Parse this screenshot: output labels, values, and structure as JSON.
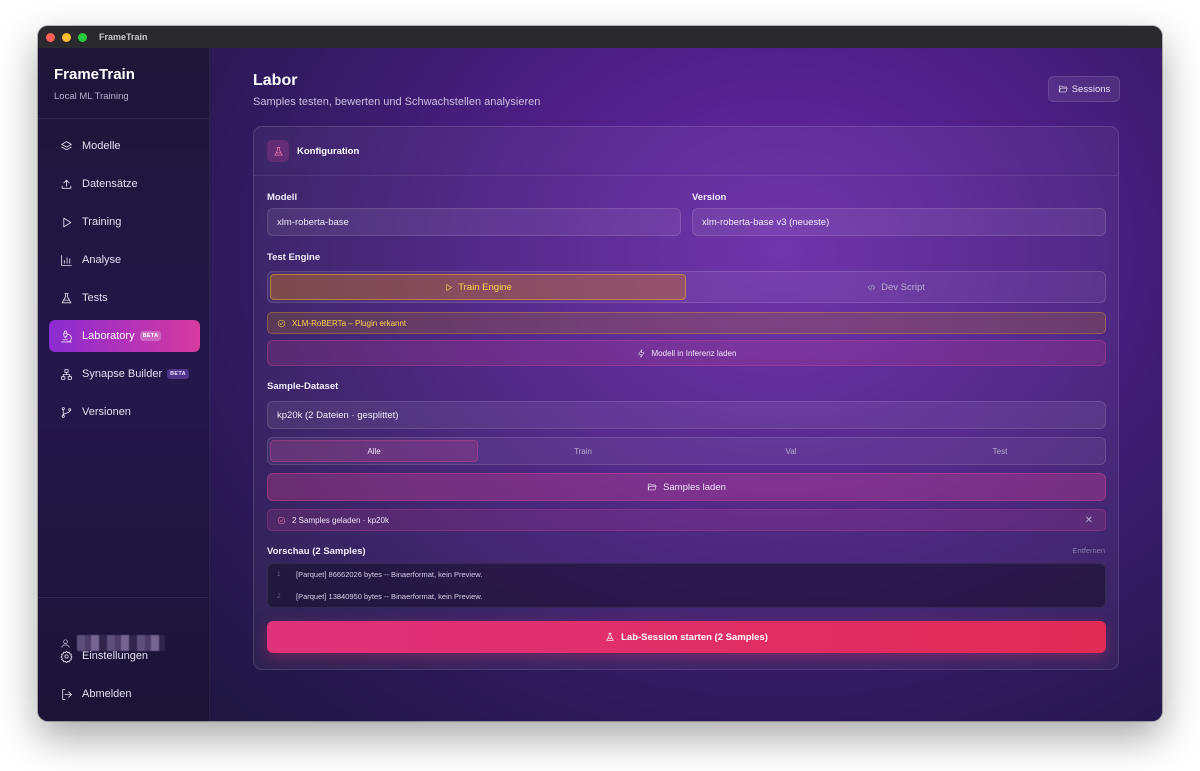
{
  "window": {
    "title": "FrameTrain"
  },
  "sidebar": {
    "app_name": "FrameTrain",
    "app_sub": "Local ML Training",
    "items": [
      {
        "label": "Modelle",
        "icon": "layers-icon"
      },
      {
        "label": "Datensätze",
        "icon": "upload-icon"
      },
      {
        "label": "Training",
        "icon": "play-icon"
      },
      {
        "label": "Analyse",
        "icon": "bar-chart-icon"
      },
      {
        "label": "Tests",
        "icon": "flask-icon"
      },
      {
        "label": "Laboratory",
        "icon": "microscope-icon",
        "badge": "BETA",
        "active": true
      },
      {
        "label": "Synapse Builder",
        "icon": "network-icon",
        "badge": "BETA"
      },
      {
        "label": "Versionen",
        "icon": "git-branch-icon"
      }
    ],
    "settings_label": "Einstellungen",
    "logout_label": "Abmelden"
  },
  "header": {
    "title": "Labor",
    "subtitle": "Samples testen, bewerten und Schwachstellen analysieren",
    "sessions_label": "Sessions"
  },
  "config": {
    "title": "Konfiguration",
    "model_label": "Modell",
    "model_value": "xlm-roberta-base",
    "version_label": "Version",
    "version_value": "xlm-roberta-base v3 (neueste)",
    "engine_label": "Test Engine",
    "engine_options": [
      "Train Engine",
      "Dev Script"
    ],
    "engine_selected": "Train Engine",
    "plugin_notice": "XLM-RoBERTa – Plugin erkannt",
    "load_inference_label": "Modell in Inferenz laden",
    "dataset_label": "Sample-Dataset",
    "dataset_value": "kp20k (2 Dateien · gesplittet)",
    "split_options": [
      "Alle",
      "Train",
      "Val",
      "Test"
    ],
    "split_selected": "Alle",
    "load_samples_label": "Samples laden",
    "loaded_notice": "2 Samples geladen · kp20k",
    "preview_label": "Vorschau (2 Samples)",
    "remove_label": "Entfernen",
    "preview_rows": [
      {
        "num": "1",
        "text": "[Parquet] 86662026 bytes -- Binaerformat, kein Preview."
      },
      {
        "num": "2",
        "text": "[Parquet] 13840950 bytes -- Binaerformat, kein Preview."
      }
    ],
    "start_label": "Lab-Session starten (2 Samples)"
  },
  "colors": {
    "accent": "#d73aa0",
    "start": "#e12a55",
    "amber": "#fcd34d"
  }
}
